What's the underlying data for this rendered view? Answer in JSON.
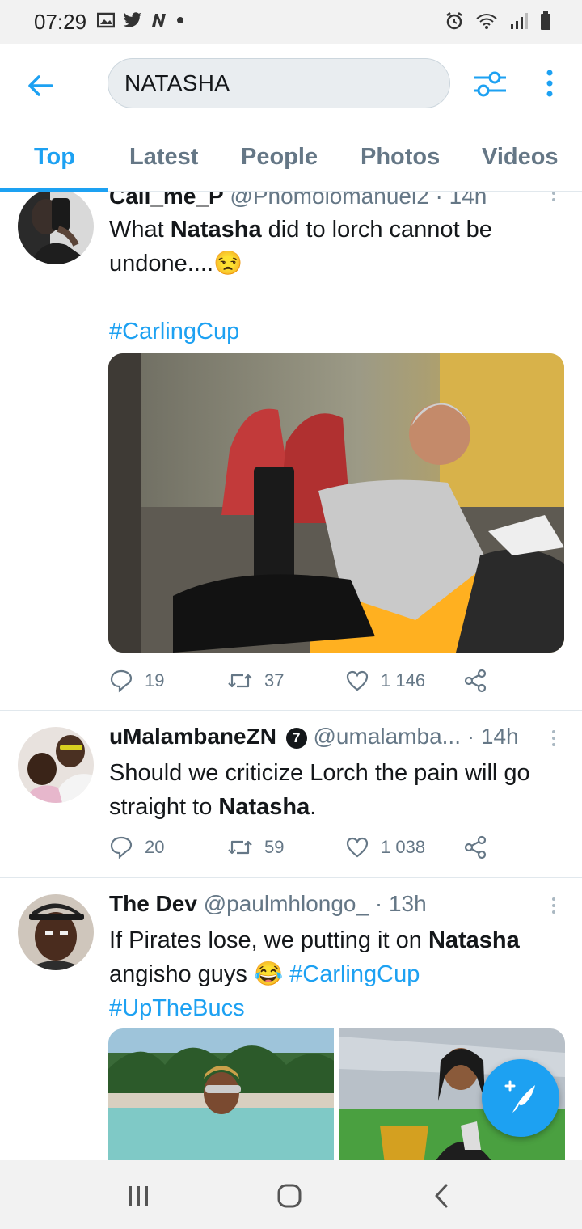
{
  "status_bar": {
    "time": "07:29"
  },
  "search": {
    "query": "NATASHA"
  },
  "tabs": [
    {
      "label": "Top",
      "active": true
    },
    {
      "label": "Latest"
    },
    {
      "label": "People"
    },
    {
      "label": "Photos"
    },
    {
      "label": "Videos"
    }
  ],
  "tweets": [
    {
      "name": "Call_me_P",
      "handle": "@Phomolomanuel2",
      "time": "· 14h",
      "text_before": "What ",
      "text_bold": "Natasha",
      "text_after": " did to lorch cannot be undone....😒",
      "hashtag": "#CarlingCup",
      "replies": "19",
      "retweets": "37",
      "likes": "1 146"
    },
    {
      "name": "uMalambaneZN",
      "badge": "7",
      "handle": "@umalamba...",
      "time": "· 14h",
      "text_before": "Should we criticize Lorch the pain will go straight to ",
      "text_bold": "Natasha",
      "text_after": ".",
      "replies": "20",
      "retweets": "59",
      "likes": "1 038"
    },
    {
      "name": "The Dev",
      "handle": "@paulmhlongo_",
      "time": "· 13h",
      "text_before": "If Pirates lose, we putting it on ",
      "text_bold": "Natasha",
      "text_after": " angisho guys 😂 ",
      "hashtag1": "#CarlingCup",
      "hashtag2": "#UpTheBucs"
    }
  ],
  "colors": {
    "accent": "#1da1f2",
    "muted": "#657786",
    "text": "#14171a"
  },
  "icons": [
    "back-arrow-icon",
    "filter-icon",
    "more-vertical-icon",
    "reply-icon",
    "retweet-icon",
    "like-icon",
    "share-icon",
    "compose-tweet-icon"
  ]
}
